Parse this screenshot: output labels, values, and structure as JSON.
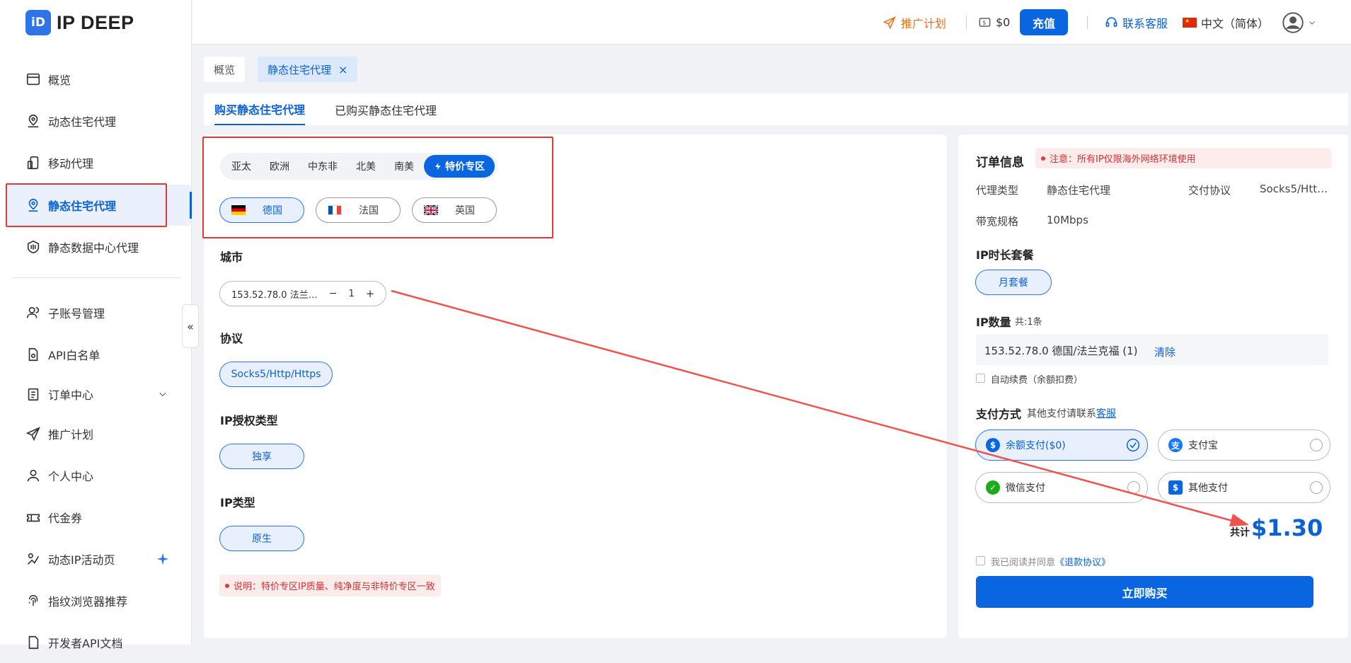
{
  "brand": {
    "logo_mark": "iD",
    "name": "IP DEEP"
  },
  "sidebar": {
    "items": [
      {
        "label": "概览",
        "icon": "overview-icon"
      },
      {
        "label": "动态住宅代理",
        "icon": "location-user-icon"
      },
      {
        "label": "移动代理",
        "icon": "mobile-icon"
      },
      {
        "label": "静态住宅代理",
        "icon": "location-pin-icon",
        "active": true
      },
      {
        "label": "静态数据中心代理",
        "icon": "datacenter-icon"
      },
      {
        "label": "子账号管理",
        "icon": "users-icon"
      },
      {
        "label": "API白名单",
        "icon": "api-file-icon"
      },
      {
        "label": "订单中心",
        "icon": "order-icon"
      },
      {
        "label": "推广计划",
        "icon": "send-icon"
      },
      {
        "label": "个人中心",
        "icon": "user-icon"
      },
      {
        "label": "代金券",
        "icon": "ticket-icon"
      },
      {
        "label": "动态IP活动页",
        "icon": "activity-icon"
      },
      {
        "label": "指纹浏览器推荐",
        "icon": "fingerprint-icon"
      },
      {
        "label": "开发者API文档",
        "icon": "doc-icon"
      }
    ],
    "collapse_symbol": "«"
  },
  "topbar": {
    "promo": "推广计划",
    "balance": "$0",
    "recharge": "充值",
    "support": "联系客服",
    "language": "中文（简体）"
  },
  "page_tabs": [
    "概览",
    "静态住宅代理"
  ],
  "page_tab_close": "×",
  "sub_tabs": [
    "购买静态住宅代理",
    "已购买静态住宅代理"
  ],
  "regions": [
    "亚太",
    "欧洲",
    "中东非",
    "北美",
    "南美",
    "特价专区"
  ],
  "countries": [
    "德国",
    "法国",
    "英国"
  ],
  "city": {
    "label": "城市",
    "ip_value": "153.52.78.0 法兰…",
    "minus": "−",
    "qty": "1",
    "plus": "+"
  },
  "protocol": {
    "label": "协议",
    "value": "Socks5/Http/Https"
  },
  "auth": {
    "label": "IP授权类型",
    "value": "独享"
  },
  "iptype": {
    "label": "IP类型",
    "value": "原生"
  },
  "note": "说明：特价专区IP质量、纯净度与非特价专区一致",
  "order": {
    "title": "订单信息",
    "notice": "注意：所有IP仅限海外网络环境使用",
    "proxy_type_label": "代理类型",
    "proxy_type": "静态住宅代理",
    "protocol_label": "交付协议",
    "protocol": "Socks5/Htt…",
    "bandwidth_label": "带宽规格",
    "bandwidth": "10Mbps",
    "package_label": "IP时长套餐",
    "package": "月套餐",
    "qty_label": "IP数量",
    "qty_count": "共:1条",
    "ip_item": "153.52.78.0 德国/法兰克福 (1)",
    "clear": "清除",
    "auto_renew": "自动续费（余额扣费）",
    "pay_label": "支付方式",
    "pay_hint": "其他支付请联系",
    "pay_hint_link": "客服",
    "payments": [
      "余额支付($0)",
      "支付宝",
      "微信支付",
      "其他支付"
    ],
    "total_label": "共计",
    "total": "$1.30",
    "agree": "我已阅读并同意",
    "agree_link": "《退款协议》",
    "buy": "立即购买"
  }
}
